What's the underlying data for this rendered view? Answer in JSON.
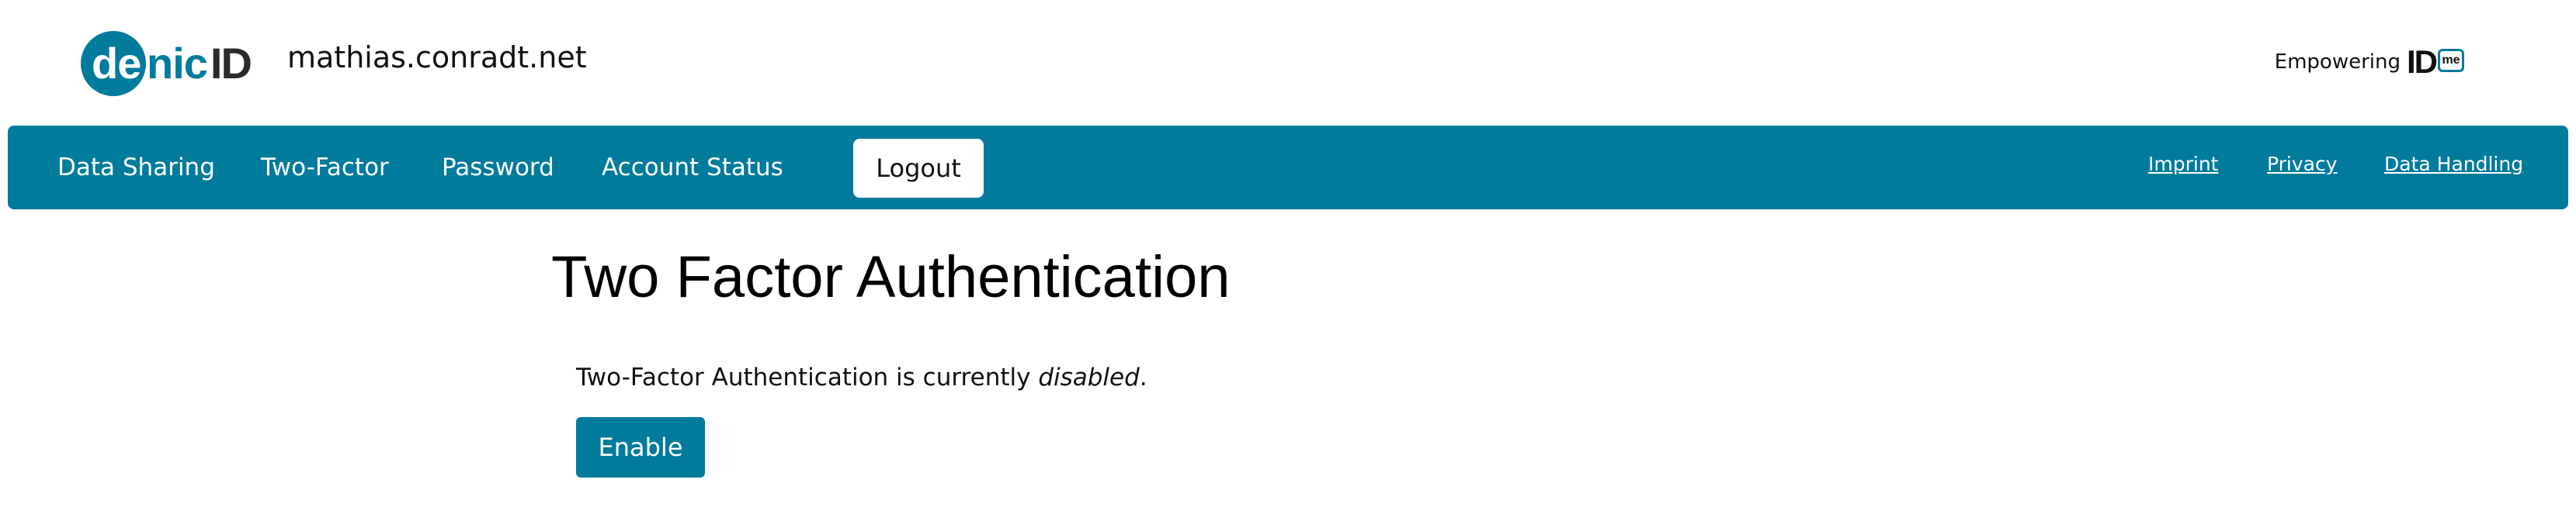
{
  "brand": {
    "logo_de": "de",
    "logo_nic": "nic",
    "logo_id": "ID",
    "domain": "mathias.conradt.net",
    "empowering_text": "Empowering",
    "partner_logo_id": "ID",
    "partner_logo_me": "me",
    "accent_color": "#017b9c"
  },
  "nav": {
    "items": [
      {
        "label": "Data Sharing"
      },
      {
        "label": "Two-Factor"
      },
      {
        "label": "Password"
      },
      {
        "label": "Account Status"
      }
    ],
    "logout_label": "Logout",
    "links": [
      {
        "label": "Imprint"
      },
      {
        "label": "Privacy"
      },
      {
        "label": "Data Handling"
      }
    ]
  },
  "main": {
    "title": "Two Factor Authentication",
    "status_prefix": "Two-Factor Authentication is currently ",
    "status_value": "disabled",
    "status_suffix": ".",
    "enable_label": "Enable"
  }
}
